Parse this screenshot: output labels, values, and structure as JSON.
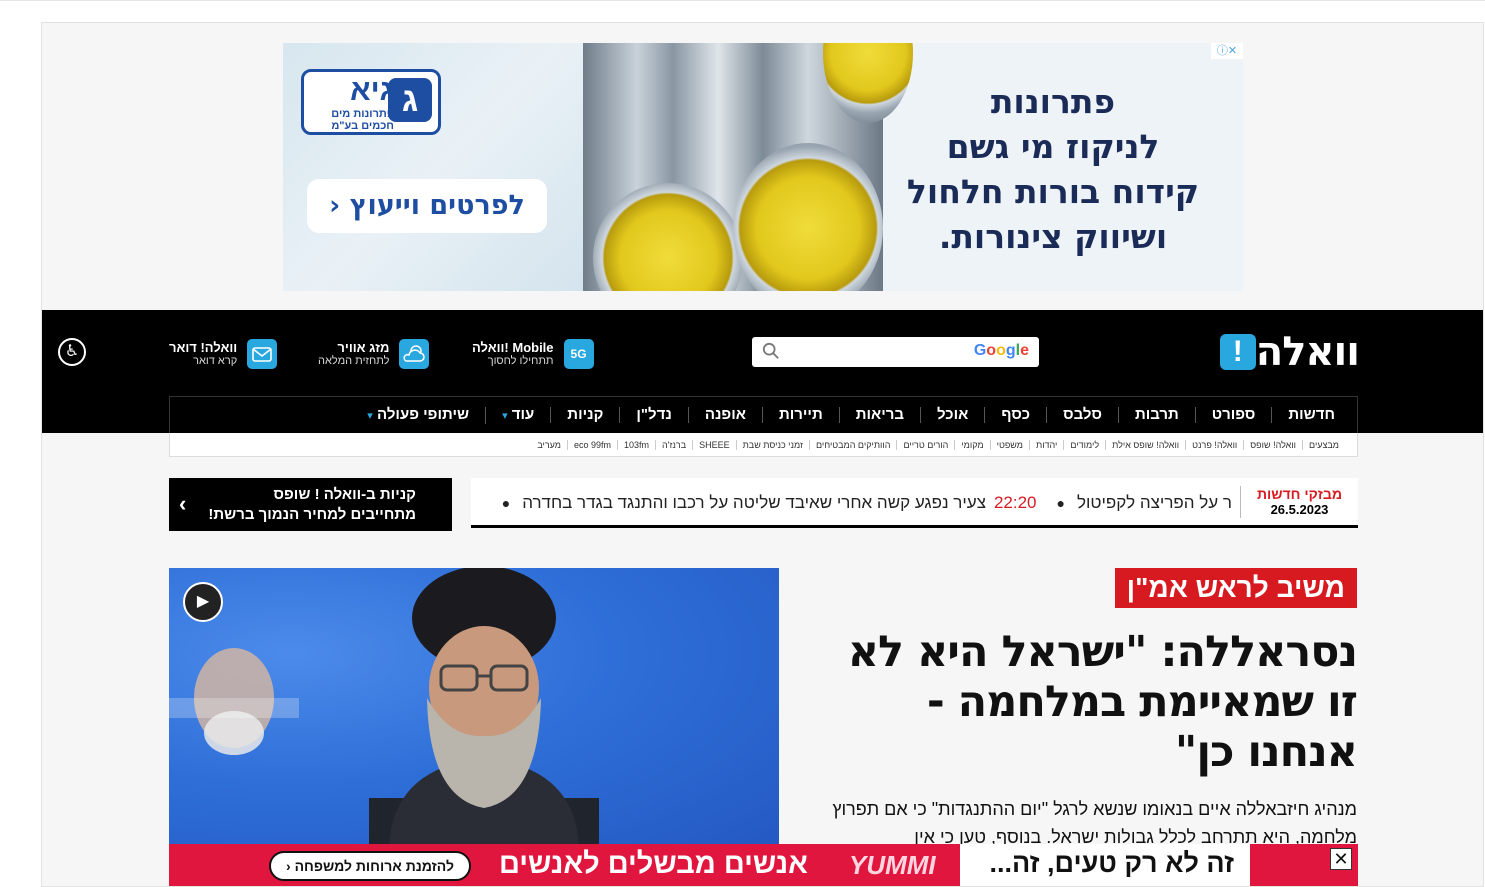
{
  "top_ad": {
    "headline_lines": [
      "פתרונות",
      "לניקוז מי גשם",
      "קידוח בורות חלחול",
      "ושיווק צינורות."
    ],
    "brand": "גיא",
    "brand_sub_1": "פתרונות מים",
    "brand_sub_2": "חכמים בע\"מ",
    "cta": "לפרטים וייעוץ ‹",
    "choices": "ⓘ✕"
  },
  "header": {
    "logo_text": "וואלה",
    "logo_mark": "!",
    "search_brand": "Google",
    "mobile_title": "וואלה! Mobile",
    "mobile_sub": "תתחילו לחסוך",
    "mobile_badge": "5G",
    "weather_title": "מזג אוויר",
    "weather_sub": "לתחזית המלאה",
    "mail_title": "וואלה! דואר",
    "mail_sub": "קרא דואר",
    "accessibility_glyph": "♿"
  },
  "nav": {
    "items": [
      "חדשות",
      "ספורט",
      "תרבות",
      "סלבס",
      "כסף",
      "אוכל",
      "בריאות",
      "תיירות",
      "אופנה",
      "נדל\"ן",
      "קניות",
      "עוד",
      "שיתופי פעולה"
    ],
    "more_chevron": "⌄"
  },
  "subnav": {
    "items": [
      "מבצעים",
      "וואלה! שופס",
      "וואלה! פרנט",
      "וואלה! שופס אילת",
      "לימודים",
      "יהדות",
      "משפטי",
      "מקומי",
      "הורים טריים",
      "הוותיקים המבטיחים",
      "זמני כניסת שבת",
      "SHEEE",
      "ברנז'ה",
      "103fm",
      "eco 99fm",
      "מעריב"
    ]
  },
  "ticker": {
    "title": "מבזקי חדשות",
    "date": "26.5.2023",
    "item1_partial": "ר על הפריצה לקפיטול",
    "item2_time": "22:20",
    "item2_text": "צעיר נפגע קשה אחרי שאיבד שליטה על רכבו והתנגד בגדר בחדרה"
  },
  "shops": {
    "line1": "קניות ב-וואלה ! שופס",
    "line2": "מתחייבים למחיר הנמוך ברשת!",
    "chevron": "‹"
  },
  "article": {
    "kicker": "משיב לראש אמ\"ן",
    "headline": "נסראללה: \"ישראל היא לא זו שמאיימת במלחמה - אנחנו כן\"",
    "summary": "מנהיג חיזבאללה איים בנאומו שנשא לרגל \"יום ההתנגדות\" כי אם תפרוץ מלחמה, היא תתרחב לכלל גבולות ישראל. בנוסף, טען כי אין",
    "play_glyph": "▶"
  },
  "bottom_ad": {
    "text_right": "זה לא רק טעים, זה...",
    "brand": "YUMMI",
    "text_main": "אנשים מבשלים לאנשים",
    "cta": "להזמנת ארוחות למשפחה ‹",
    "close": "✕"
  },
  "colors": {
    "brand_blue": "#29a8e0",
    "breaking_red": "#d71920",
    "ad_navy": "#1a2b57",
    "bottom_ad_red": "#e0163e"
  }
}
